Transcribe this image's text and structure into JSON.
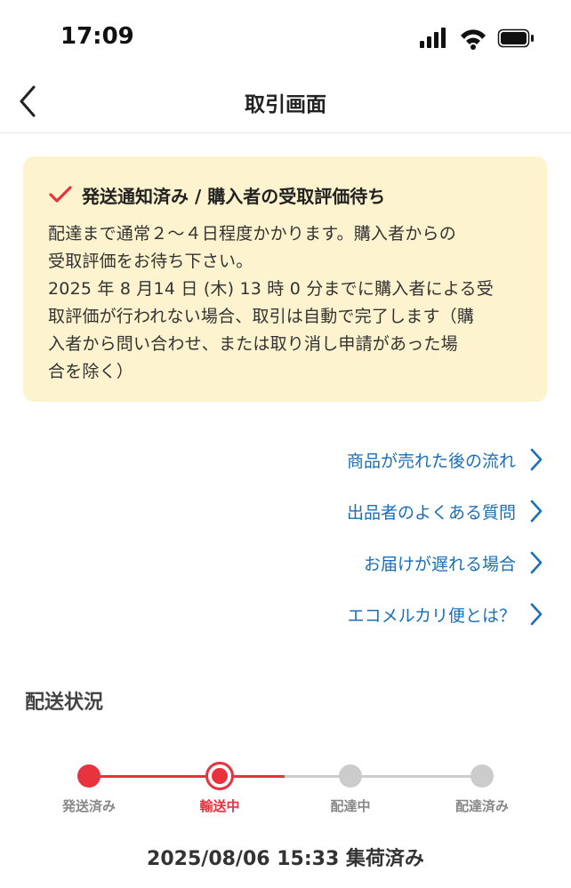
{
  "status_bar": {
    "time": "17:09"
  },
  "nav": {
    "title": "取引画面"
  },
  "notice": {
    "title": "発送通知済み / 購入者の受取評価待ち",
    "body": "配達まで通常２〜４日程度かかります。購入者からの\n受取評価をお待ち下さい。\n2025 年 8 月14 日 (木) 13 時 0 分までに購入者による受\n取評価が行われない場合、取引は自動で完了します（購\n入者から問い合わせ、または取り消し申請があった場\n合を除く）",
    "accent_color": "#e8323e",
    "background_color": "#fdf3ce"
  },
  "links": [
    {
      "label": "商品が売れた後の流れ"
    },
    {
      "label": "出品者のよくある質問"
    },
    {
      "label": "お届けが遅れる場合"
    },
    {
      "label": "エコメルカリ便とは？"
    }
  ],
  "shipping": {
    "section_title": "配送状況",
    "steps": [
      {
        "label": "発送済み",
        "state": "done"
      },
      {
        "label": "輸送中",
        "state": "current"
      },
      {
        "label": "配達中",
        "state": "pending"
      },
      {
        "label": "配達済み",
        "state": "pending"
      }
    ],
    "latest_event": "2025/08/06 15:33 集荷済み",
    "active_color": "#e8323e",
    "inactive_color": "#cccccc"
  }
}
